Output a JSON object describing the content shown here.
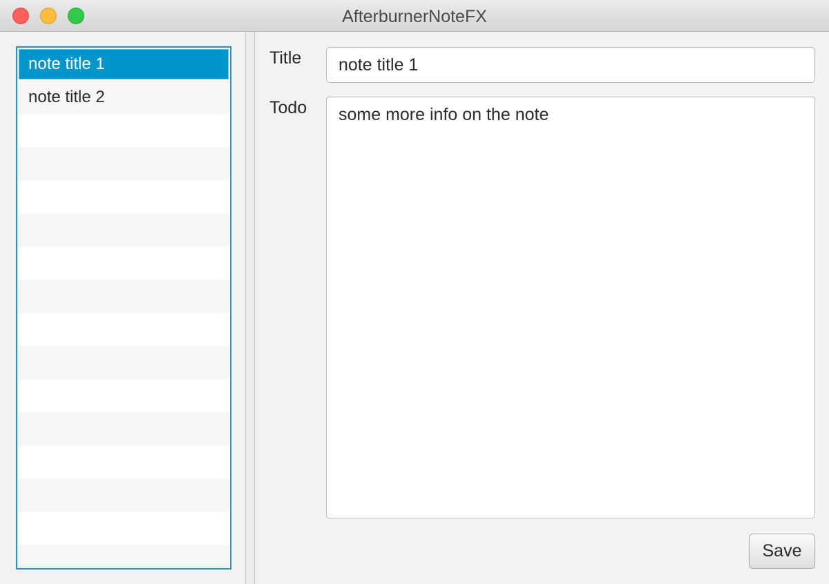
{
  "window": {
    "title": "AfterburnerNoteFX"
  },
  "note_list": {
    "items": [
      {
        "label": "note title 1",
        "selected": true
      },
      {
        "label": "note title 2",
        "selected": false
      }
    ]
  },
  "form": {
    "title_label": "Title",
    "title_value": "note title 1",
    "todo_label": "Todo",
    "todo_value": "some more info on the note",
    "save_label": "Save"
  },
  "colors": {
    "selection": "#0096c9",
    "focus_border": "#1a96d4",
    "close": "#fc605c",
    "minimize": "#fdbc40",
    "maximize": "#34c84a"
  }
}
